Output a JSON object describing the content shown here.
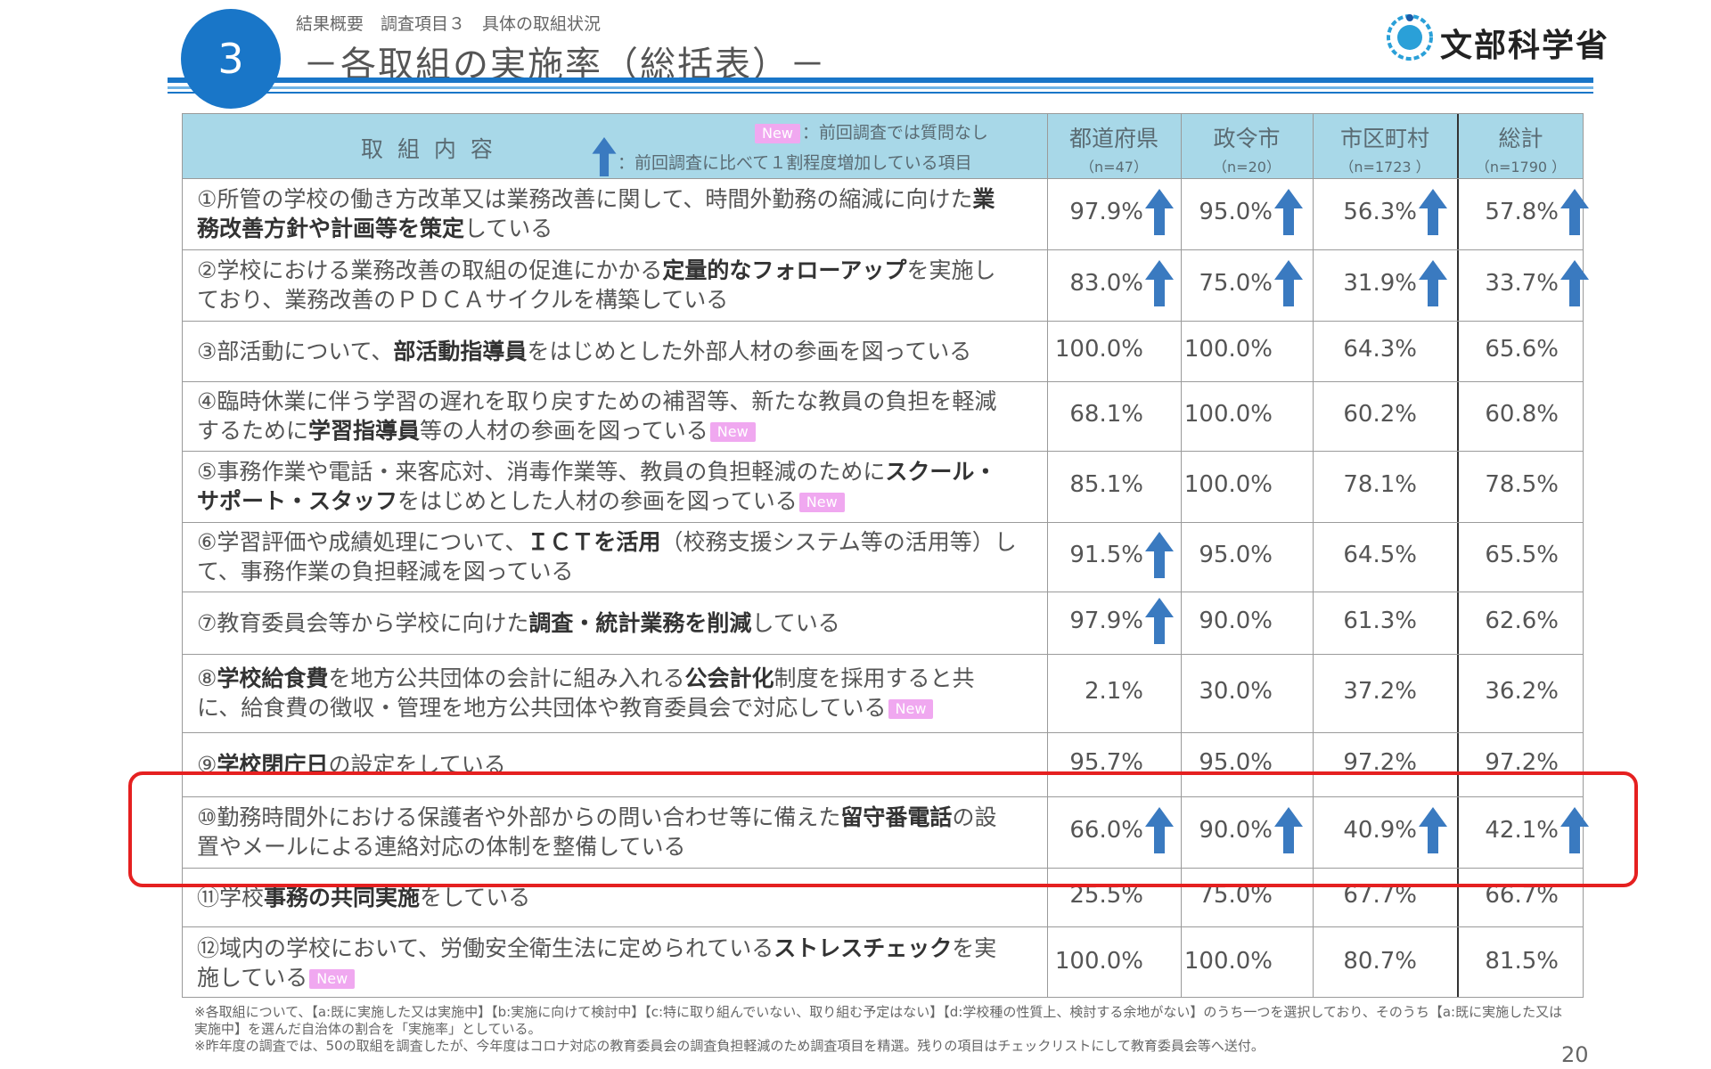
{
  "header": {
    "section_number": "3",
    "breadcrumb": "結果概要　調査項目３　具体の取組状況",
    "title": "－各取組の実施率（総括表）－",
    "logo_text": "文部科学省",
    "accent_color": "#1976c8"
  },
  "table": {
    "item_header": "取 組 内 容",
    "legend_new_tag": "New",
    "legend_new_text": "：前回調査では質問なし",
    "legend_arrow_text": "：前回調査に比べて１割程度増加している項目",
    "columns": [
      {
        "title": "都道府県",
        "n": "（n=47）"
      },
      {
        "title": "政令市",
        "n": "（n=20）"
      },
      {
        "title": "市区町村",
        "n": "（n=1723 ）"
      },
      {
        "title": "総計",
        "n": "（n=1790 ）"
      }
    ],
    "rows": [
      {
        "pre": "①所管の学校の働き方改革又は業務改善に関して、時間外勤務の縮減に向けた",
        "bold": "業務改善方針や計画等を策定",
        "post": "している",
        "values": [
          "97.9%",
          "95.0%",
          "56.3%",
          "57.8%"
        ]
      },
      {
        "pre": "②学校における業務改善の取組の促進にかかる",
        "bold": "定量的なフォローアップ",
        "post": "を実施しており、業務改善のＰＤＣＡサイクルを構築している",
        "values": [
          "83.0%",
          "75.0%",
          "31.9%",
          "33.7%"
        ]
      },
      {
        "pre": "③部活動について、",
        "bold": "部活動指導員",
        "post": "をはじめとした外部人材の参画を図っている",
        "values": [
          "100.0%",
          "100.0%",
          "64.3%",
          "65.6%"
        ]
      },
      {
        "pre": "④臨時休業に伴う学習の遅れを取り戻すための補習等、新たな教員の負担を軽減するために",
        "bold": "学習指導員",
        "post": "等の人材の参画を図っている",
        "tag": "New",
        "values": [
          "68.1%",
          "100.0%",
          "60.2%",
          "60.8%"
        ]
      },
      {
        "pre": "⑤事務作業や電話・来客応対、消毒作業等、教員の負担軽減のために",
        "bold": "スクール・サポート・スタッフ",
        "post": "をはじめとした人材の参画を図っている",
        "tag": "New",
        "values": [
          "85.1%",
          "100.0%",
          "78.1%",
          "78.5%"
        ]
      },
      {
        "pre": "⑥学習評価や成績処理について、",
        "bold": "ＩＣＴを活用",
        "post": "（校務支援システム等の活用等）して、事務作業の負担軽減を図っている",
        "values": [
          "91.5%",
          "95.0%",
          "64.5%",
          "65.5%"
        ]
      },
      {
        "pre": "⑦教育委員会等から学校に向けた",
        "bold": "調査・統計業務を削減",
        "post": "している",
        "values": [
          "97.9%",
          "90.0%",
          "61.3%",
          "62.6%"
        ]
      },
      {
        "pre": "⑧",
        "bold": "学校給食費",
        "post": "を地方公共団体の会計に組み入れる",
        "bold2": "公会計化",
        "post2": "制度を採用すると共に、給食費の徴収・管理を地方公共団体や教育委員会で対応している",
        "tag": "New",
        "values": [
          "2.1%",
          "30.0%",
          "37.2%",
          "36.2%"
        ]
      },
      {
        "pre": "⑨",
        "bold": "学校閉庁日",
        "post": "の設定をしている",
        "values": [
          "95.7%",
          "95.0%",
          "97.2%",
          "97.2%"
        ]
      },
      {
        "pre": "⑩勤務時間外における保護者や外部からの問い合わせ等に備えた",
        "bold": "留守番電話",
        "post": "の設置やメールによる連絡対応の体制を整備している",
        "values": [
          "66.0%",
          "90.0%",
          "40.9%",
          "42.1%"
        ]
      },
      {
        "pre": "⑪学校",
        "bold": "事務の共同実施",
        "post": "をしている",
        "values": [
          "25.5%",
          "75.0%",
          "67.7%",
          "66.7%"
        ]
      },
      {
        "pre": "⑫域内の学校において、労働安全衛生法に定められている",
        "bold": "ストレスチェック",
        "post": "を実施している",
        "tag": "New",
        "values": [
          "100.0%",
          "100.0%",
          "80.7%",
          "81.5%"
        ]
      }
    ]
  },
  "footnote": [
    "※各取組について、【a:既に実施した又は実施中】【b:実施に向けて検討中】【c:特に取り組んでいない、取り組む予定はない】【d:学校種の性質上、検討する余地がない】のうち一つを選択しており、そのうち【a:既に実施した又は実施中】を選んだ自治体の割合を「実施率」としている。",
    "※昨年度の調査では、50の取組を調査したが、今年度はコロナ対応の教育委員会の調査負担軽減のため調査項目を精選。残りの項目はチェックリストにして教育委員会等へ送付。"
  ],
  "page_number": "20",
  "colors": {
    "header_bg": "#a8d8e8",
    "new_tag": "#f0a8f0",
    "arrow": "#3a7ac0",
    "highlight": "#e52020"
  }
}
